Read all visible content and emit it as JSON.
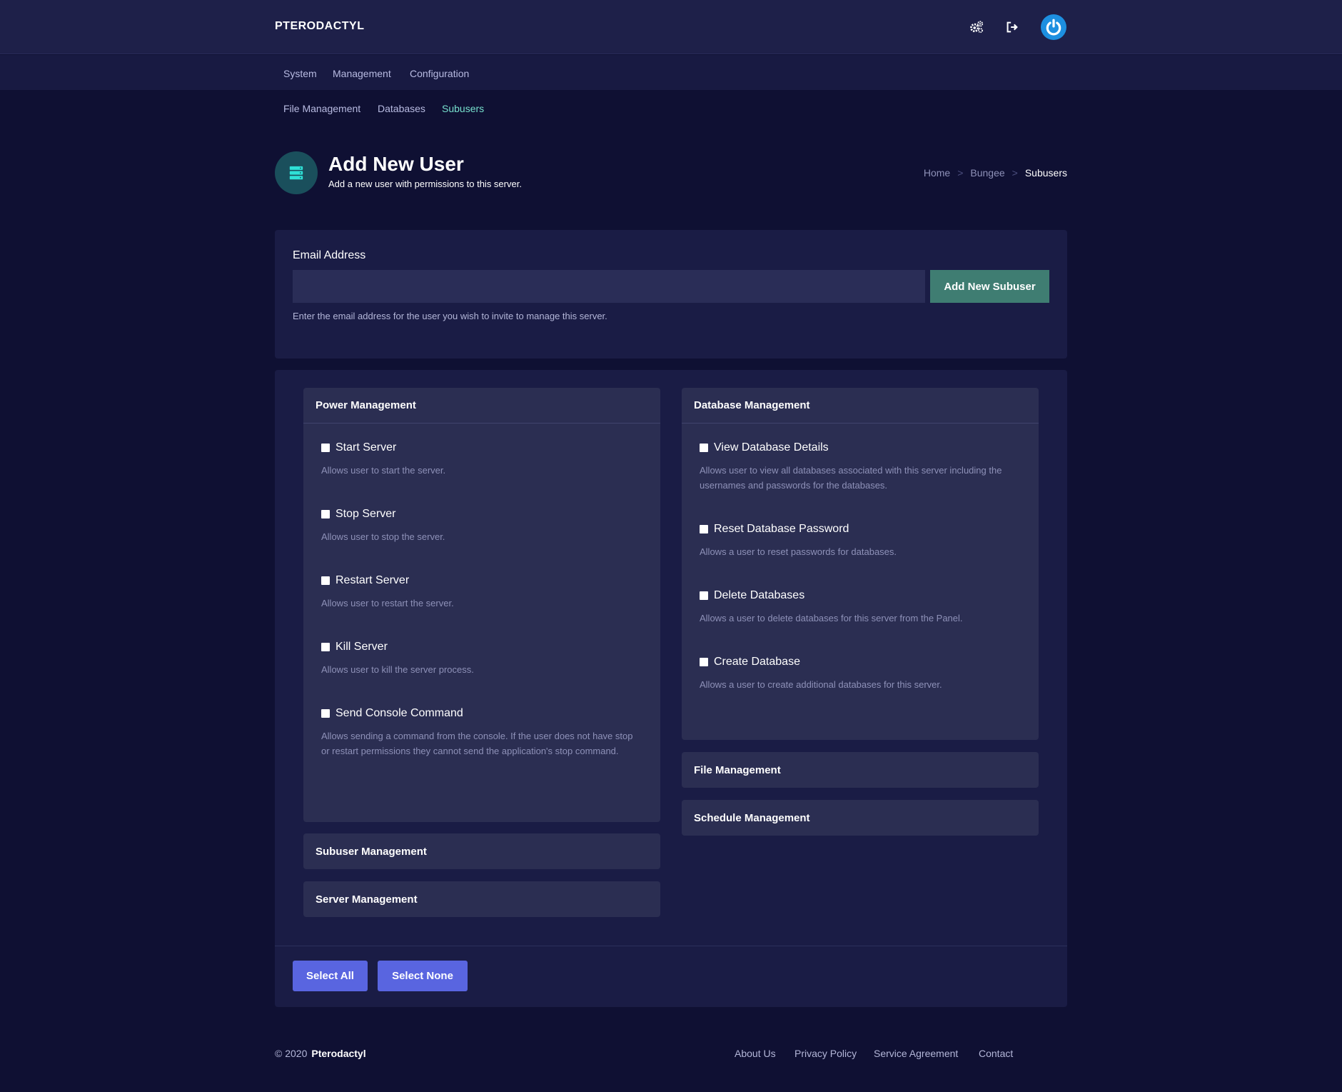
{
  "brand": "PTERODACTYL",
  "topbar_icons": [
    "gears-icon",
    "logout-icon",
    "power-logo-icon"
  ],
  "nav": {
    "items": [
      {
        "label": "System"
      },
      {
        "label": "Management"
      },
      {
        "label": "Configuration"
      }
    ]
  },
  "subnav": {
    "items": [
      {
        "label": "File Management",
        "active": false
      },
      {
        "label": "Databases",
        "active": false
      },
      {
        "label": "Subusers",
        "active": true
      }
    ]
  },
  "header": {
    "title": "Add New User",
    "subtitle": "Add a new user with permissions to this server.",
    "icon": "server-icon"
  },
  "breadcrumb": {
    "items": [
      "Home",
      "Bungee",
      "Subusers"
    ],
    "separator": ">"
  },
  "email_form": {
    "label": "Email Address",
    "value": "",
    "placeholder": "",
    "submit_label": "Add New Subuser",
    "help": "Enter the email address for the user you wish to invite to manage this server."
  },
  "permissions": {
    "power": {
      "title": "Power Management",
      "items": [
        {
          "title": "Start Server",
          "desc": "Allows user to start the server."
        },
        {
          "title": "Stop Server",
          "desc": "Allows user to stop the server."
        },
        {
          "title": "Restart Server",
          "desc": "Allows user to restart the server."
        },
        {
          "title": "Kill Server",
          "desc": "Allows user to kill the server process."
        },
        {
          "title": "Send Console Command",
          "desc": "Allows sending a command from the console. If the user does not have stop or restart permissions they cannot send the application's stop command."
        }
      ]
    },
    "database": {
      "title": "Database Management",
      "items": [
        {
          "title": "View Database Details",
          "desc": "Allows user to view all databases associated with this server including the usernames and passwords for the databases."
        },
        {
          "title": "Reset Database Password",
          "desc": "Allows a user to reset passwords for databases."
        },
        {
          "title": "Delete Databases",
          "desc": "Allows a user to delete databases for this server from the Panel."
        },
        {
          "title": "Create Database",
          "desc": "Allows a user to create additional databases for this server."
        }
      ]
    },
    "collapsed": {
      "subuser": "Subuser Management",
      "server": "Server Management",
      "file": "File Management",
      "schedule": "Schedule Management"
    }
  },
  "actions": {
    "select_all": "Select All",
    "select_none": "Select None"
  },
  "footer": {
    "copyright": "© 2020",
    "brand": "Pterodactyl",
    "links": [
      "About Us",
      "Privacy Policy",
      "Service Agreement",
      "Contact"
    ]
  },
  "colors": {
    "background": "#0f1033",
    "topbar": "#1e2049",
    "card": "#1a1c45",
    "panel": "#2b2e52",
    "accent_teal": "#3f7d72",
    "active_tab": "#77e0cd",
    "button_blue": "#5965e0"
  }
}
